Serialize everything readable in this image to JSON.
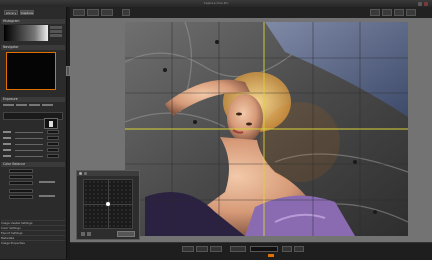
{
  "window": {
    "title": "Capture One Pro"
  },
  "left_panel": {
    "tabs": [
      "Library",
      "Capture"
    ],
    "sections": [
      {
        "label": "Histogram"
      },
      {
        "label": "Navigator"
      },
      {
        "label": "Exposure"
      },
      {
        "label": "Color Balance"
      }
    ],
    "bottom_sections": [
      {
        "label": "Image Usable Settings"
      },
      {
        "label": "Color Settings"
      },
      {
        "label": "Export Settings"
      },
      {
        "label": "Metadata"
      },
      {
        "label": "Image Properties"
      }
    ]
  },
  "colors": {
    "grid": "#d9d23a",
    "accent": "#e07000",
    "panel": "#2b2b2b"
  }
}
